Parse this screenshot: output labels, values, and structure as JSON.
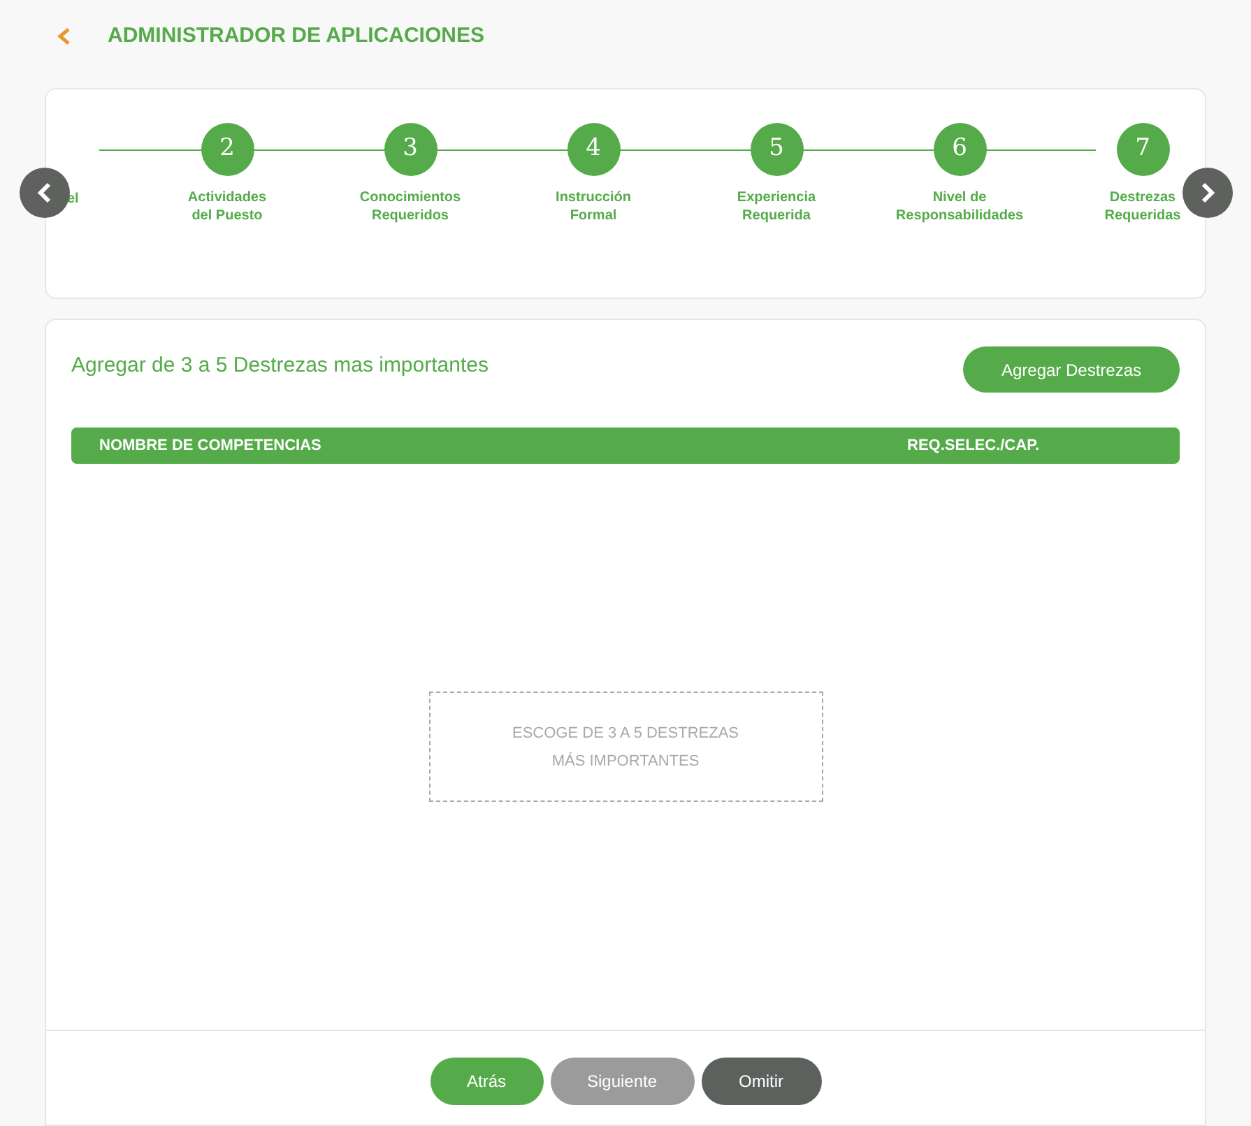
{
  "header": {
    "title": "ADMINISTRADOR DE APLICACIONES"
  },
  "stepper": {
    "cut_label": "el",
    "steps": [
      {
        "number": "2",
        "label_lines": [
          "Actividades",
          "del Puesto"
        ]
      },
      {
        "number": "3",
        "label_lines": [
          "Conocimientos",
          "Requeridos"
        ]
      },
      {
        "number": "4",
        "label_lines": [
          "Instrucción",
          "Formal"
        ]
      },
      {
        "number": "5",
        "label_lines": [
          "Experiencia",
          "Requerida"
        ]
      },
      {
        "number": "6",
        "label_lines": [
          "Nivel de",
          "Responsabilidades"
        ]
      },
      {
        "number": "7",
        "label_lines": [
          "Destrezas",
          "Requeridas"
        ]
      }
    ]
  },
  "section": {
    "heading": "Agregar de 3 a 5 Destrezas mas importantes",
    "add_button": "Agregar Destrezas"
  },
  "table": {
    "columns": [
      "NOMBRE DE COMPETENCIAS",
      "REQ.SELEC./CAP."
    ]
  },
  "empty_state": {
    "lines": [
      "ESCOGE DE 3 A 5 DESTREZAS",
      "MÁS IMPORTANTES"
    ]
  },
  "footer": {
    "buttons": [
      {
        "label": "Atrás",
        "kind": "primary"
      },
      {
        "label": "Siguiente",
        "kind": "disabled"
      },
      {
        "label": "Omitir",
        "kind": "dark"
      }
    ]
  }
}
